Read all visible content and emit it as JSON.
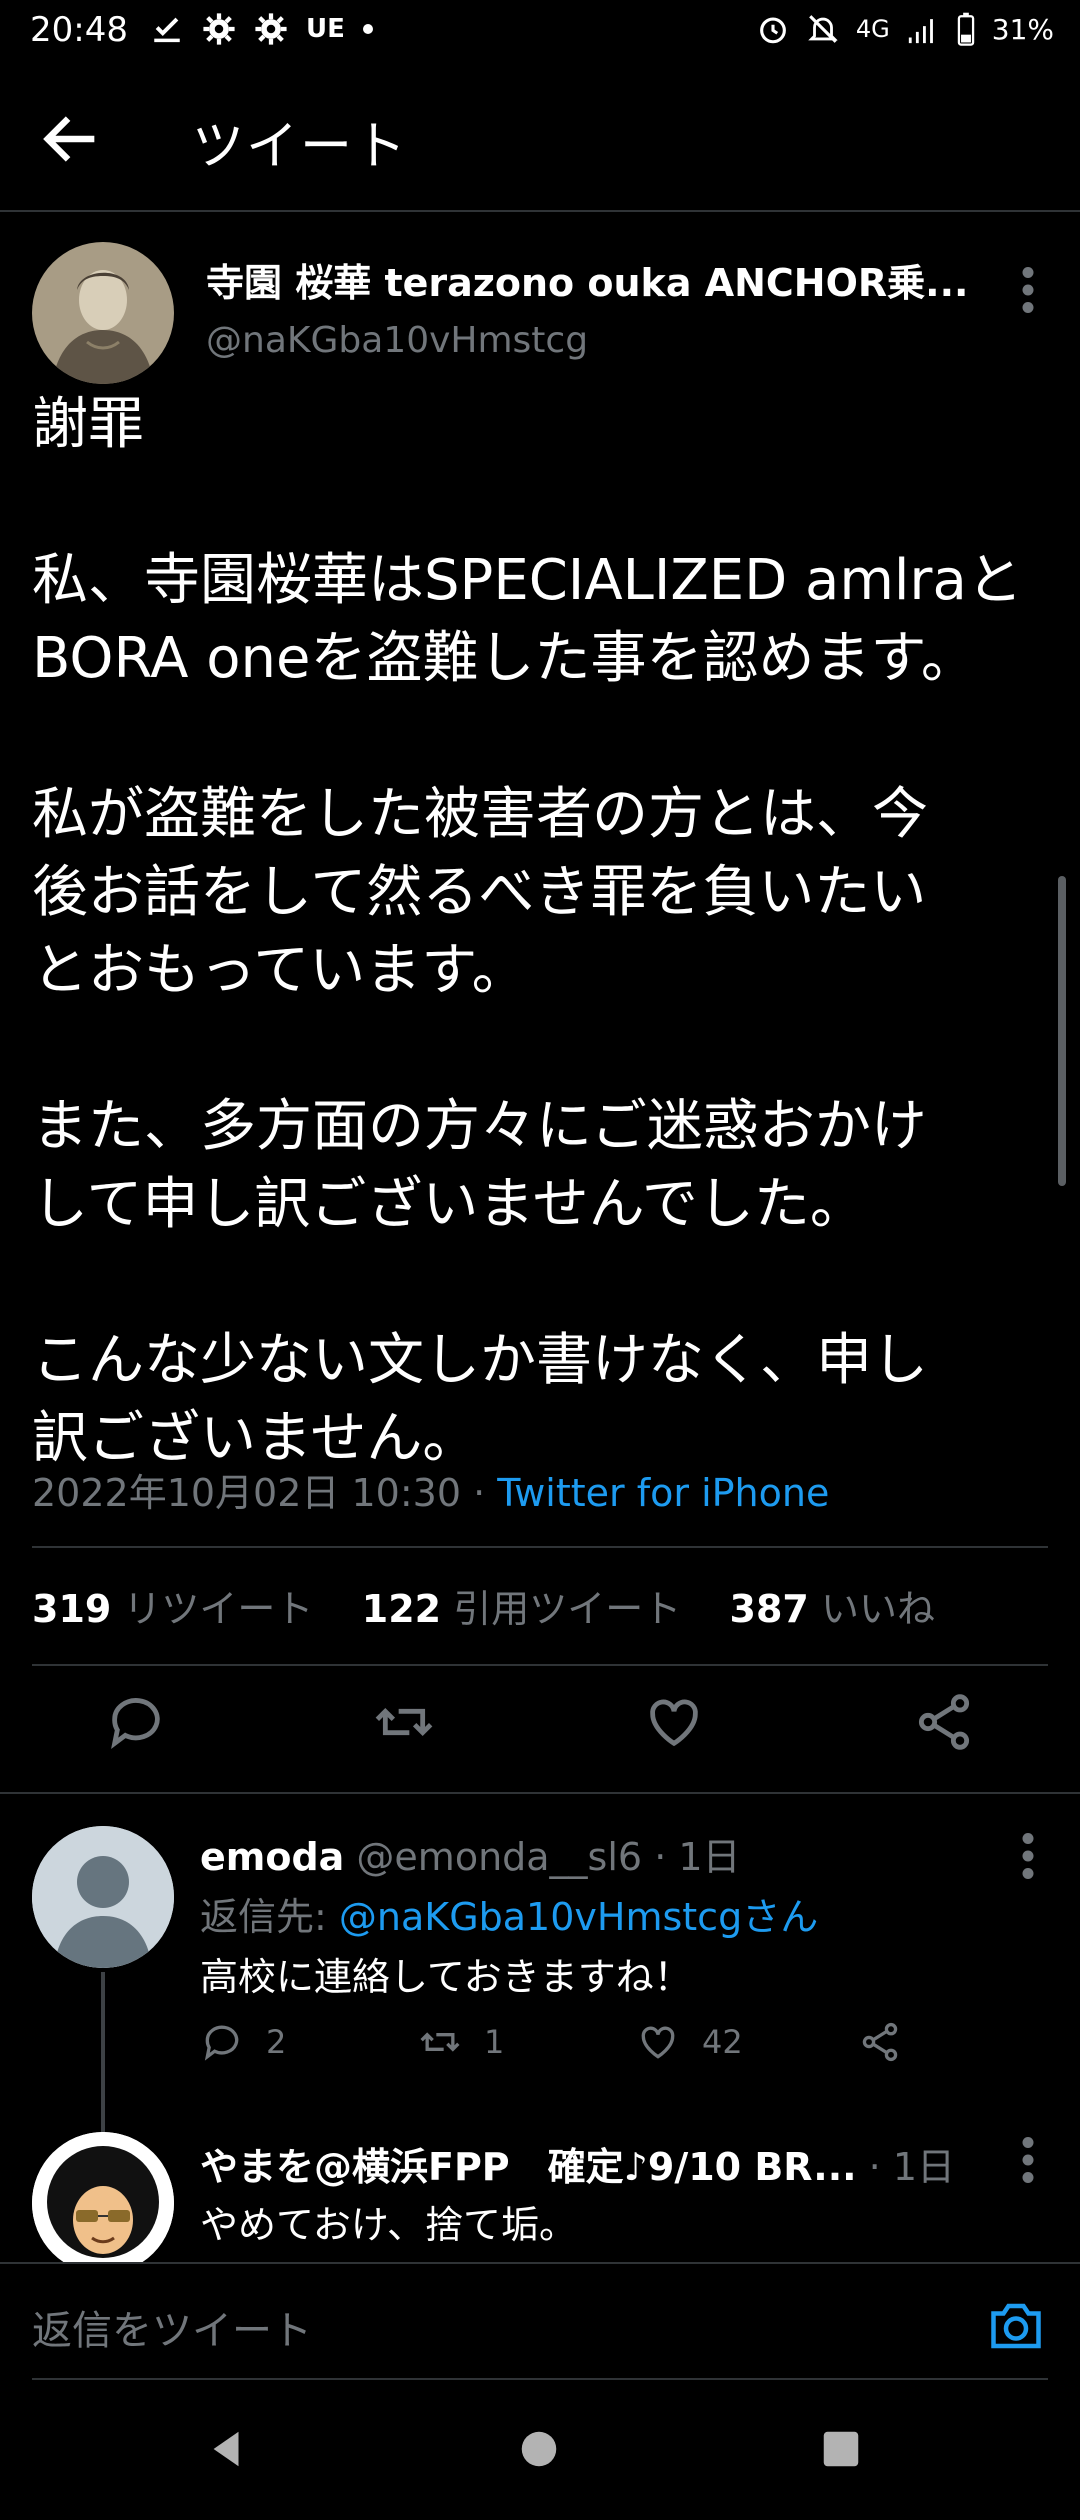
{
  "status_bar": {
    "time": "20:48",
    "left_icons": [
      "check-icon",
      "gear-icon",
      "gear-icon",
      "UE",
      "dot"
    ],
    "carrier_text": "UE",
    "network": "4G",
    "battery": "31%"
  },
  "header": {
    "title": "ツイート"
  },
  "tweet": {
    "author_name": "寺園 桜華 terazono ouka ANCHOR乗...",
    "author_handle": "@naKGba10vHmstcg",
    "text": "謝罪\n\n私、寺園桜華はSPECIALIZED amlraと\nBORA oneを盗難した事を認めます。\n\n私が盗難をした被害者の方とは、今\n後お話をして然るべき罪を負いたい\nとおもっています。\n\nまた、多方面の方々にご迷惑おかけ\nして申し訳ございませんでした。\n\nこんな少ない文しか書けなく、申し\n訳ございません。",
    "timestamp": "2022年10月02日 10:30",
    "separator": "·",
    "source": "Twitter for iPhone",
    "retweets": "319",
    "retweets_label": "リツイート",
    "quotes": "122",
    "quotes_label": "引用ツイート",
    "likes": "387",
    "likes_label": "いいね"
  },
  "replies": [
    {
      "name": "emoda",
      "handle": "@emonda__sl6",
      "time": "· 1日",
      "reply_to_label": "返信先:",
      "reply_to_handle": "@naKGba10vHmstcgさん",
      "text": "高校に連絡しておきますね！",
      "reply_count": "2",
      "retweet_count": "1",
      "like_count": "42"
    },
    {
      "name": "やまを@横浜FPP　確定♪9/10 BR...",
      "time": "· 1日",
      "text": "やめておけ、捨て垢。"
    }
  ],
  "composer": {
    "placeholder": "返信をツイート"
  },
  "colors": {
    "background": "#000000",
    "accent": "#1d9bf0",
    "muted": "#71767b",
    "divider": "#2f3336"
  }
}
